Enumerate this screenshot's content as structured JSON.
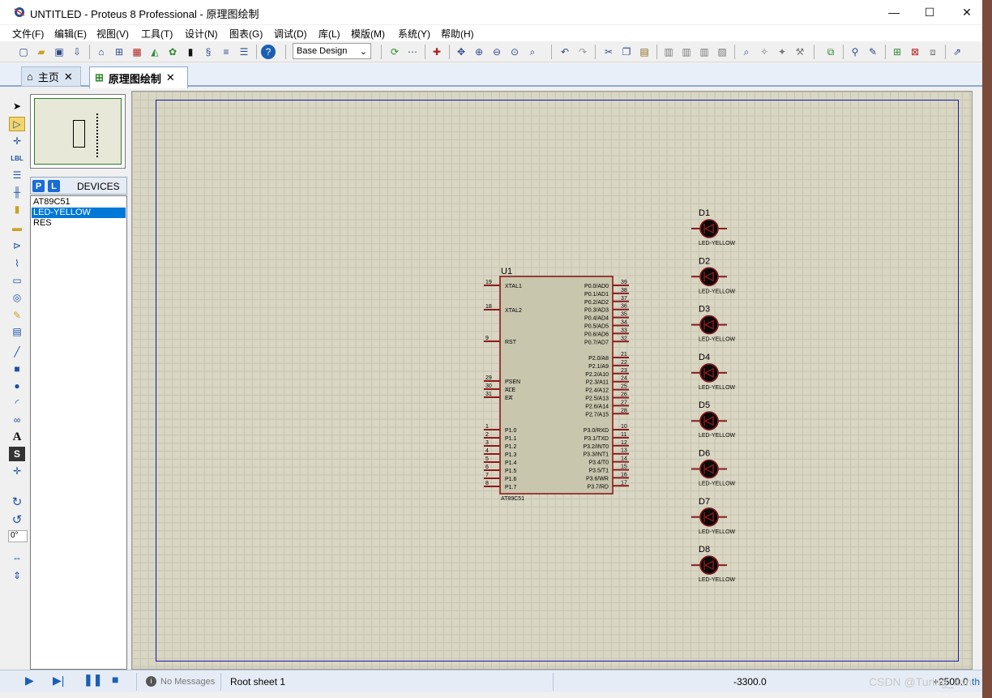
{
  "window": {
    "title": "UNTITLED - Proteus 8 Professional - 原理图绘制",
    "minimize": "—",
    "maximize": "☐",
    "close": "✕"
  },
  "menu": [
    "文件(F)",
    "编辑(E)",
    "视图(V)",
    "工具(T)",
    "设计(N)",
    "图表(G)",
    "调试(D)",
    "库(L)",
    "模版(M)",
    "系统(Y)",
    "帮助(H)"
  ],
  "toolbar": {
    "design_select": "Base Design"
  },
  "tabs": {
    "home": "主页",
    "schematic": "原理图绘制",
    "close": "✕"
  },
  "devices": {
    "p_button": "P",
    "l_button": "L",
    "header": "DEVICES",
    "items": [
      "AT89C51",
      "LED-YELLOW",
      "RES"
    ],
    "selected_index": 1
  },
  "rotation": "0°",
  "schematic": {
    "chip": {
      "ref": "U1",
      "part": "AT89C51",
      "left_pins": [
        {
          "num": "19",
          "name": "XTAL1"
        },
        {
          "num": "18",
          "name": "XTAL2"
        },
        {
          "num": "9",
          "name": "RST"
        },
        {
          "num": "29",
          "name": "PSEN"
        },
        {
          "num": "30",
          "name": "ALE"
        },
        {
          "num": "31",
          "name": "EA"
        },
        {
          "num": "1",
          "name": "P1.0"
        },
        {
          "num": "2",
          "name": "P1.1"
        },
        {
          "num": "3",
          "name": "P1.2"
        },
        {
          "num": "4",
          "name": "P1.3"
        },
        {
          "num": "5",
          "name": "P1.4"
        },
        {
          "num": "6",
          "name": "P1.5"
        },
        {
          "num": "7",
          "name": "P1.6"
        },
        {
          "num": "8",
          "name": "P1.7"
        }
      ],
      "right_pins": [
        {
          "num": "39",
          "name": "P0.0/AD0"
        },
        {
          "num": "38",
          "name": "P0.1/AD1"
        },
        {
          "num": "37",
          "name": "P0.2/AD2"
        },
        {
          "num": "36",
          "name": "P0.3/AD3"
        },
        {
          "num": "35",
          "name": "P0.4/AD4"
        },
        {
          "num": "34",
          "name": "P0.5/AD5"
        },
        {
          "num": "33",
          "name": "P0.6/AD6"
        },
        {
          "num": "32",
          "name": "P0.7/AD7"
        },
        {
          "num": "21",
          "name": "P2.0/A8"
        },
        {
          "num": "22",
          "name": "P2.1/A9"
        },
        {
          "num": "23",
          "name": "P2.2/A10"
        },
        {
          "num": "24",
          "name": "P2.3/A11"
        },
        {
          "num": "25",
          "name": "P2.4/A12"
        },
        {
          "num": "26",
          "name": "P2.5/A13"
        },
        {
          "num": "27",
          "name": "P2.6/A14"
        },
        {
          "num": "28",
          "name": "P2.7/A15"
        },
        {
          "num": "10",
          "name": "P3.0/RXD"
        },
        {
          "num": "11",
          "name": "P3.1/TXD"
        },
        {
          "num": "12",
          "name": "P3.2/INT0"
        },
        {
          "num": "13",
          "name": "P3.3/INT1"
        },
        {
          "num": "14",
          "name": "P3.4/T0"
        },
        {
          "num": "15",
          "name": "P3.5/T1"
        },
        {
          "num": "16",
          "name": "P3.6/WR"
        },
        {
          "num": "17",
          "name": "P3.7/RD"
        }
      ]
    },
    "leds": [
      {
        "ref": "D1",
        "part": "LED-YELLOW"
      },
      {
        "ref": "D2",
        "part": "LED-YELLOW"
      },
      {
        "ref": "D3",
        "part": "LED-YELLOW"
      },
      {
        "ref": "D4",
        "part": "LED-YELLOW"
      },
      {
        "ref": "D5",
        "part": "LED-YELLOW"
      },
      {
        "ref": "D6",
        "part": "LED-YELLOW"
      },
      {
        "ref": "D7",
        "part": "LED-YELLOW"
      },
      {
        "ref": "D8",
        "part": "LED-YELLOW"
      }
    ]
  },
  "status": {
    "messages": "No Messages",
    "sheet": "Root sheet 1",
    "x": "-3300.0",
    "y": "+2500.0",
    "unit": "th"
  },
  "watermark": "CSDN @Turing_kun",
  "colors": {
    "component_outline": "#8b1a1a",
    "chip_fill": "#c8c6ad",
    "sheet_border": "#1a1aa8",
    "selection": "#0078d7"
  }
}
